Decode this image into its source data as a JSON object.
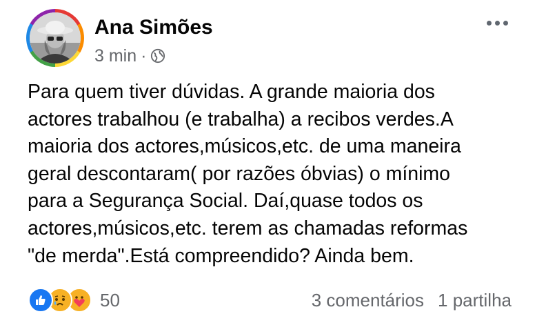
{
  "author": {
    "name": "Ana Simões"
  },
  "post": {
    "time": "3 min",
    "separator": "·",
    "privacy_icon": "globe-icon",
    "text": "Para quem tiver dúvidas. A grande maioria dos\nactores trabalhou (e trabalha) a recibos verdes.A\nmaioria dos actores,músicos,etc. de uma maneira\ngeral descontaram( por razões óbvias) o mínimo\npara a Segurança Social. Daí,quase todos os\nactores,músicos,etc. terem as chamadas reformas\n\"de merda\".Está compreendido? Ainda bem."
  },
  "reactions": {
    "icons": [
      "like-icon",
      "sad-icon",
      "care-icon"
    ],
    "count": "50"
  },
  "stats": {
    "comments": "3 comentários",
    "shares": "1 partilha"
  },
  "colors": {
    "like": "#1877f2",
    "meta_text": "#65676b",
    "emoji_yellow": "#f7b125",
    "care_red": "#f33e58"
  }
}
